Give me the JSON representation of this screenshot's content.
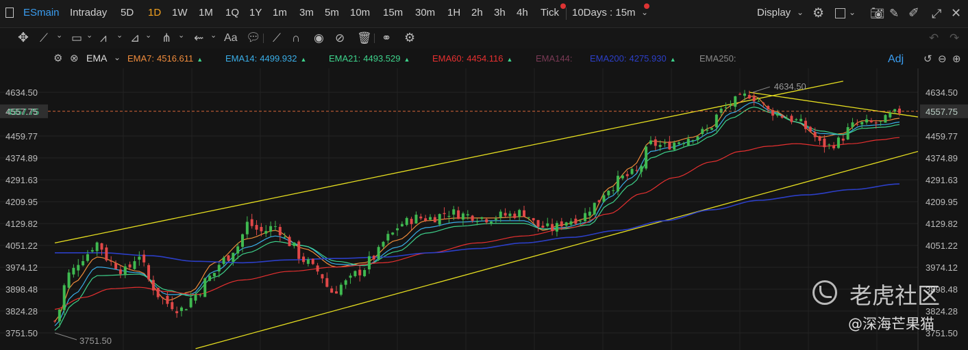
{
  "topbar": {
    "symbol": "ESmain",
    "periods": [
      "Intraday",
      "5D",
      "1D",
      "1W",
      "1M",
      "1Q",
      "1Y",
      "1m",
      "3m",
      "5m",
      "10m",
      "15m",
      "30m",
      "1H",
      "2h",
      "3h",
      "4h",
      "Tick"
    ],
    "active_period": "1D",
    "range_label": "10Days : 15m",
    "display_label": "Display",
    "icons": [
      "gear-icon",
      "square-icon",
      "camera-icon",
      "edit-icon",
      "pencil-icon",
      "fullscreen-icon"
    ]
  },
  "toolbar": {
    "text_tool": "Aa",
    "tools": [
      "move-icon",
      "line-icon",
      "rect-icon",
      "polyline-icon",
      "fib-icon",
      "pitchfork-icon",
      "arrow-icon",
      "text-icon",
      "comment-icon",
      "ruler-icon",
      "magnet-icon",
      "eye-icon",
      "hide-icon",
      "trash-icon",
      "link-icon",
      "settings-icon"
    ]
  },
  "ema_bar": {
    "name": "EMA",
    "items": [
      {
        "label": "EMA7:",
        "value": "4516.611",
        "color": "#f08c3c",
        "arrow": "▲"
      },
      {
        "label": "EMA14:",
        "value": "4499.932",
        "color": "#3aaee8",
        "arrow": "▲"
      },
      {
        "label": "EMA21:",
        "value": "4493.529",
        "color": "#3ed38c",
        "arrow": "▲"
      },
      {
        "label": "EMA60:",
        "value": "4454.116",
        "color": "#e83030",
        "arrow": "▲"
      },
      {
        "label": "EMA144:",
        "value": "",
        "color": "#7a3a55",
        "arrow": ""
      },
      {
        "label": "EMA200:",
        "value": "4275.930",
        "color": "#2c3fc8",
        "arrow": "▲"
      },
      {
        "label": "EMA250:",
        "value": "",
        "color": "#8a8a8a",
        "arrow": ""
      }
    ],
    "adj_label": "Adj"
  },
  "watermark": {
    "brand": "老虎社区",
    "author": "@深海芒果猫"
  },
  "chart_data": {
    "type": "candlestick",
    "y_ticks": [
      "4634.50",
      "4557.75",
      "4459.77",
      "4374.89",
      "4291.63",
      "4209.95",
      "4129.82",
      "4051.22",
      "3974.12",
      "3898.48",
      "3824.28",
      "3751.50"
    ],
    "ylim": [
      3751.5,
      4634.5
    ],
    "y_scale": "log",
    "grid": true,
    "last_price": "4557.75",
    "last_price_value": 4557.75,
    "high_label": "4634.50",
    "low_label": "3751.50",
    "colors": {
      "up": "#3fb950",
      "down": "#e04848",
      "trendline": "#e8e020",
      "last_price": "#d9673a"
    },
    "trendlines": [
      {
        "name": "upper-channel",
        "points": [
          [
            0,
            4060
          ],
          [
            168,
            4680
          ]
        ]
      },
      {
        "name": "lower-channel",
        "points": [
          [
            30,
            3700
          ],
          [
            195,
            4455
          ]
        ]
      },
      {
        "name": "descending-resistance",
        "points": [
          [
            148,
            4634.5
          ],
          [
            195,
            4505
          ]
        ]
      }
    ],
    "ema_series": [
      {
        "label": "EMA7",
        "color": "#f08c3c",
        "anchors": [
          [
            0,
            3790
          ],
          [
            4,
            3920
          ],
          [
            9,
            4010
          ],
          [
            18,
            3960
          ],
          [
            24,
            3860
          ],
          [
            29,
            3890
          ],
          [
            34,
            3990
          ],
          [
            41,
            4075
          ],
          [
            47,
            4105
          ],
          [
            53,
            4040
          ],
          [
            60,
            3975
          ],
          [
            66,
            3990
          ],
          [
            73,
            4070
          ],
          [
            79,
            4140
          ],
          [
            86,
            4150
          ],
          [
            93,
            4150
          ],
          [
            100,
            4155
          ],
          [
            104,
            4105
          ],
          [
            108,
            4125
          ],
          [
            114,
            4150
          ],
          [
            118,
            4260
          ],
          [
            123,
            4340
          ],
          [
            127,
            4440
          ],
          [
            131,
            4435
          ],
          [
            136,
            4455
          ],
          [
            140,
            4495
          ],
          [
            144,
            4580
          ],
          [
            149,
            4620
          ],
          [
            153,
            4560
          ],
          [
            158,
            4515
          ],
          [
            163,
            4455
          ],
          [
            168,
            4470
          ],
          [
            172,
            4520
          ],
          [
            177,
            4520
          ],
          [
            180,
            4530
          ]
        ]
      },
      {
        "label": "EMA14",
        "color": "#3aaee8",
        "anchors": [
          [
            0,
            3775
          ],
          [
            4,
            3880
          ],
          [
            9,
            3975
          ],
          [
            18,
            3955
          ],
          [
            24,
            3880
          ],
          [
            29,
            3880
          ],
          [
            34,
            3960
          ],
          [
            41,
            4045
          ],
          [
            47,
            4085
          ],
          [
            53,
            4050
          ],
          [
            60,
            3985
          ],
          [
            66,
            3980
          ],
          [
            73,
            4045
          ],
          [
            79,
            4115
          ],
          [
            86,
            4135
          ],
          [
            93,
            4140
          ],
          [
            100,
            4140
          ],
          [
            104,
            4110
          ],
          [
            108,
            4115
          ],
          [
            114,
            4135
          ],
          [
            118,
            4225
          ],
          [
            123,
            4300
          ],
          [
            127,
            4400
          ],
          [
            131,
            4415
          ],
          [
            136,
            4440
          ],
          [
            140,
            4475
          ],
          [
            144,
            4550
          ],
          [
            149,
            4595
          ],
          [
            153,
            4555
          ],
          [
            158,
            4515
          ],
          [
            163,
            4470
          ],
          [
            168,
            4465
          ],
          [
            172,
            4500
          ],
          [
            177,
            4505
          ],
          [
            180,
            4515
          ]
        ]
      },
      {
        "label": "EMA21",
        "color": "#3ed38c",
        "anchors": [
          [
            0,
            3760
          ],
          [
            4,
            3850
          ],
          [
            9,
            3945
          ],
          [
            18,
            3950
          ],
          [
            24,
            3895
          ],
          [
            29,
            3875
          ],
          [
            34,
            3940
          ],
          [
            41,
            4025
          ],
          [
            47,
            4065
          ],
          [
            53,
            4050
          ],
          [
            60,
            3995
          ],
          [
            66,
            3980
          ],
          [
            73,
            4030
          ],
          [
            79,
            4095
          ],
          [
            86,
            4120
          ],
          [
            93,
            4130
          ],
          [
            100,
            4130
          ],
          [
            104,
            4110
          ],
          [
            108,
            4110
          ],
          [
            114,
            4125
          ],
          [
            118,
            4200
          ],
          [
            123,
            4275
          ],
          [
            127,
            4375
          ],
          [
            131,
            4400
          ],
          [
            136,
            4425
          ],
          [
            140,
            4460
          ],
          [
            144,
            4530
          ],
          [
            149,
            4575
          ],
          [
            153,
            4550
          ],
          [
            158,
            4515
          ],
          [
            163,
            4480
          ],
          [
            168,
            4465
          ],
          [
            172,
            4490
          ],
          [
            177,
            4495
          ],
          [
            180,
            4505
          ]
        ]
      },
      {
        "label": "EMA60",
        "color": "#e83030",
        "anchors": [
          [
            0,
            3830
          ],
          [
            6,
            3870
          ],
          [
            12,
            3900
          ],
          [
            18,
            3905
          ],
          [
            24,
            3890
          ],
          [
            30,
            3880
          ],
          [
            40,
            3930
          ],
          [
            50,
            3960
          ],
          [
            60,
            3975
          ],
          [
            70,
            3990
          ],
          [
            80,
            4025
          ],
          [
            90,
            4060
          ],
          [
            100,
            4085
          ],
          [
            110,
            4115
          ],
          [
            118,
            4165
          ],
          [
            125,
            4240
          ],
          [
            132,
            4300
          ],
          [
            140,
            4360
          ],
          [
            146,
            4400
          ],
          [
            152,
            4420
          ],
          [
            158,
            4430
          ],
          [
            164,
            4420
          ],
          [
            170,
            4430
          ],
          [
            176,
            4445
          ],
          [
            180,
            4454
          ]
        ]
      },
      {
        "label": "EMA200",
        "color": "#2c3fc8",
        "anchors": [
          [
            0,
            4025
          ],
          [
            10,
            4025
          ],
          [
            20,
            4015
          ],
          [
            30,
            3995
          ],
          [
            40,
            3990
          ],
          [
            50,
            4000
          ],
          [
            60,
            4005
          ],
          [
            70,
            4010
          ],
          [
            80,
            4025
          ],
          [
            90,
            4040
          ],
          [
            100,
            4060
          ],
          [
            110,
            4080
          ],
          [
            120,
            4105
          ],
          [
            130,
            4140
          ],
          [
            140,
            4180
          ],
          [
            150,
            4215
          ],
          [
            160,
            4235
          ],
          [
            170,
            4255
          ],
          [
            180,
            4276
          ]
        ]
      }
    ],
    "price_anchors": [
      [
        0,
        3790
      ],
      [
        3,
        3950
      ],
      [
        6,
        4010
      ],
      [
        9,
        4060
      ],
      [
        12,
        3990
      ],
      [
        15,
        3960
      ],
      [
        18,
        4020
      ],
      [
        20,
        3930
      ],
      [
        22,
        3880
      ],
      [
        24,
        3850
      ],
      [
        27,
        3830
      ],
      [
        30,
        3880
      ],
      [
        33,
        3940
      ],
      [
        36,
        4000
      ],
      [
        39,
        4050
      ],
      [
        41,
        4130
      ],
      [
        44,
        4100
      ],
      [
        47,
        4120
      ],
      [
        50,
        4060
      ],
      [
        53,
        4000
      ],
      [
        56,
        3960
      ],
      [
        59,
        3890
      ],
      [
        62,
        3920
      ],
      [
        65,
        3960
      ],
      [
        68,
        4010
      ],
      [
        71,
        4080
      ],
      [
        74,
        4130
      ],
      [
        77,
        4150
      ],
      [
        80,
        4150
      ],
      [
        84,
        4170
      ],
      [
        88,
        4160
      ],
      [
        92,
        4150
      ],
      [
        96,
        4160
      ],
      [
        100,
        4170
      ],
      [
        103,
        4120
      ],
      [
        106,
        4110
      ],
      [
        109,
        4140
      ],
      [
        112,
        4150
      ],
      [
        115,
        4200
      ],
      [
        118,
        4260
      ],
      [
        121,
        4300
      ],
      [
        124,
        4320
      ],
      [
        127,
        4430
      ],
      [
        130,
        4420
      ],
      [
        133,
        4440
      ],
      [
        136,
        4460
      ],
      [
        139,
        4480
      ],
      [
        142,
        4560
      ],
      [
        145,
        4600
      ],
      [
        148,
        4625
      ],
      [
        150,
        4600
      ],
      [
        152,
        4560
      ],
      [
        155,
        4540
      ],
      [
        158,
        4520
      ],
      [
        161,
        4480
      ],
      [
        163,
        4430
      ],
      [
        165,
        4420
      ],
      [
        167,
        4440
      ],
      [
        170,
        4500
      ],
      [
        173,
        4510
      ],
      [
        176,
        4510
      ],
      [
        178,
        4540
      ],
      [
        180,
        4558
      ]
    ]
  }
}
